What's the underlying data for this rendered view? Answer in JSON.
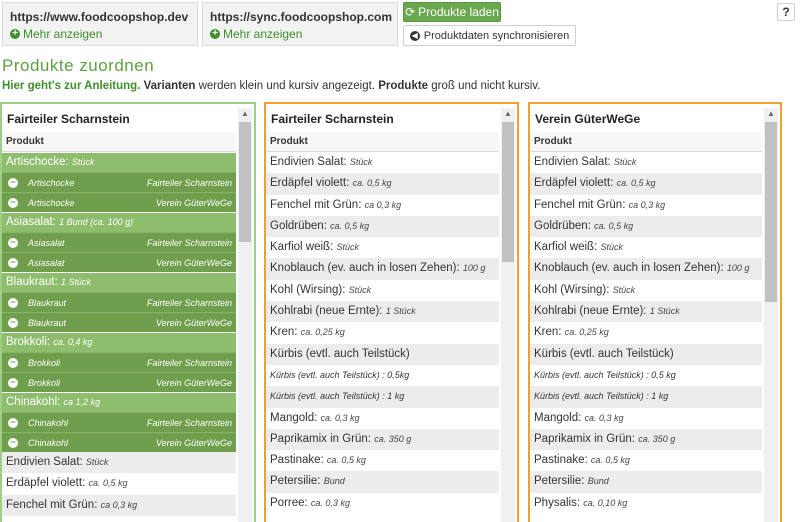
{
  "shops": [
    {
      "url": "https://www.foodcoopshop.dev",
      "more": "Mehr anzeigen"
    },
    {
      "url": "https://sync.foodcoopshop.com",
      "more": "Mehr anzeigen"
    }
  ],
  "buttons": {
    "load": "Produkte laden",
    "sync": "Produktdaten synchronisieren",
    "help": "?"
  },
  "title": "Produkte zuordnen",
  "intro": {
    "link": "Hier geht's zur Anleitung.",
    "t1": "Varianten",
    "t2": " werden klein und kursiv angezeigt. ",
    "t3": "Produkte",
    "t4": " groß und nicht kursiv."
  },
  "colors": {
    "accent": "#6aa84f",
    "panel_local": "#9fcf85",
    "panel_remote": "#f0a030"
  },
  "panels": {
    "local": {
      "title": "Fairteiler Scharnstein",
      "col": "Produkt",
      "groups": [
        {
          "name": "Artischocke:",
          "unit": "Stück",
          "lines": [
            {
              "name": "Artischocke",
              "shop": "Fairteiler Scharnstein"
            },
            {
              "name": "Artischocke",
              "shop": "Verein GüterWeGe"
            }
          ]
        },
        {
          "name": "Asiasalat:",
          "unit": "1 Bund (ca. 100 g)",
          "lines": [
            {
              "name": "Asiasalat",
              "shop": "Fairteiler Scharnstein"
            },
            {
              "name": "Asiasalat",
              "shop": "Verein GüterWeGe"
            }
          ]
        },
        {
          "name": "Blaukraut:",
          "unit": "1 Stück",
          "lines": [
            {
              "name": "Blaukraut",
              "shop": "Fairteiler Scharnstein"
            },
            {
              "name": "Blaukraut",
              "shop": "Verein GüterWeGe"
            }
          ]
        },
        {
          "name": "Brokkoli:",
          "unit": "ca. 0,4 kg",
          "lines": [
            {
              "name": "Brokkoli",
              "shop": "Fairteiler Scharnstein"
            },
            {
              "name": "Brokkoli",
              "shop": "Verein GüterWeGe"
            }
          ]
        },
        {
          "name": "Chinakohl:",
          "unit": "ca 1,2 kg",
          "lines": [
            {
              "name": "Chinakohl",
              "shop": "Fairteiler Scharnstein"
            },
            {
              "name": "Chinakohl",
              "shop": "Verein GüterWeGe"
            }
          ]
        }
      ],
      "rows": [
        {
          "name": "Endivien Salat:",
          "unit": "Stück"
        },
        {
          "name": "Erdäpfel violett:",
          "unit": "ca. 0,5 kg"
        },
        {
          "name": "Fenchel mit Grün:",
          "unit": "ca 0,3 kg"
        }
      ]
    },
    "remote1": {
      "title": "Fairteiler Scharnstein",
      "col": "Produkt",
      "rows": [
        {
          "name": "Endivien Salat:",
          "unit": "Stück"
        },
        {
          "name": "Erdäpfel violett:",
          "unit": "ca. 0,5 kg"
        },
        {
          "name": "Fenchel mit Grün:",
          "unit": "ca 0,3 kg"
        },
        {
          "name": "Goldrüben:",
          "unit": "ca. 0,5 kg"
        },
        {
          "name": "Karfiol weiß:",
          "unit": "Stück"
        },
        {
          "name": "Knoblauch (ev. auch in losen Zehen):",
          "unit": "100 g"
        },
        {
          "name": "Kohl (Wirsing):",
          "unit": "Stück"
        },
        {
          "name": "Kohlrabi (neue Ernte):",
          "unit": "1 Stück"
        },
        {
          "name": "Kren:",
          "unit": "ca. 0,25 kg"
        },
        {
          "name": "Kürbis (evtl. auch Teilstück)",
          "unit": ""
        },
        {
          "name": "Kürbis (evtl. auch Teilstück) : 0,5kg",
          "unit": "",
          "variant": true
        },
        {
          "name": "Kürbis (evtl. auch Teilstück) : 1 kg",
          "unit": "",
          "variant": true
        },
        {
          "name": "Mangold:",
          "unit": "ca. 0,3 kg"
        },
        {
          "name": "Paprikamix in Grün:",
          "unit": "ca. 350 g"
        },
        {
          "name": "Pastinake:",
          "unit": "ca. 0,5 kg"
        },
        {
          "name": "Petersilie:",
          "unit": "Bund"
        },
        {
          "name": "Porree:",
          "unit": "ca. 0,3 kg"
        }
      ]
    },
    "remote2": {
      "title": "Verein GüterWeGe",
      "col": "Produkt",
      "rows": [
        {
          "name": "Endivien Salat:",
          "unit": "Stück"
        },
        {
          "name": "Erdäpfel violett:",
          "unit": "ca. 0,5 kg"
        },
        {
          "name": "Fenchel mit Grün:",
          "unit": "ca 0,3 kg"
        },
        {
          "name": "Goldrüben:",
          "unit": "ca. 0,5 kg"
        },
        {
          "name": "Karfiol weiß:",
          "unit": "Stück"
        },
        {
          "name": "Knoblauch (ev. auch in losen Zehen):",
          "unit": "100 g"
        },
        {
          "name": "Kohl (Wirsing):",
          "unit": "Stück"
        },
        {
          "name": "Kohlrabi (neue Ernte):",
          "unit": "1 Stück"
        },
        {
          "name": "Kren:",
          "unit": "ca. 0,25 kg"
        },
        {
          "name": "Kürbis (evtl. auch Teilstück)",
          "unit": ""
        },
        {
          "name": "Kürbis (evtl. auch Teilstück) : 0,5 kg",
          "unit": "",
          "variant": true
        },
        {
          "name": "Kürbis (evtl. auch Teilstück) : 1 kg",
          "unit": "",
          "variant": true
        },
        {
          "name": "Mangold:",
          "unit": "ca. 0,3 kg"
        },
        {
          "name": "Paprikamix in Grün:",
          "unit": "ca. 350 g"
        },
        {
          "name": "Pastinake:",
          "unit": "ca. 0,5 kg"
        },
        {
          "name": "Petersilie:",
          "unit": "Bund"
        },
        {
          "name": "Physalis:",
          "unit": "ca. 0,10 kg"
        }
      ]
    }
  }
}
